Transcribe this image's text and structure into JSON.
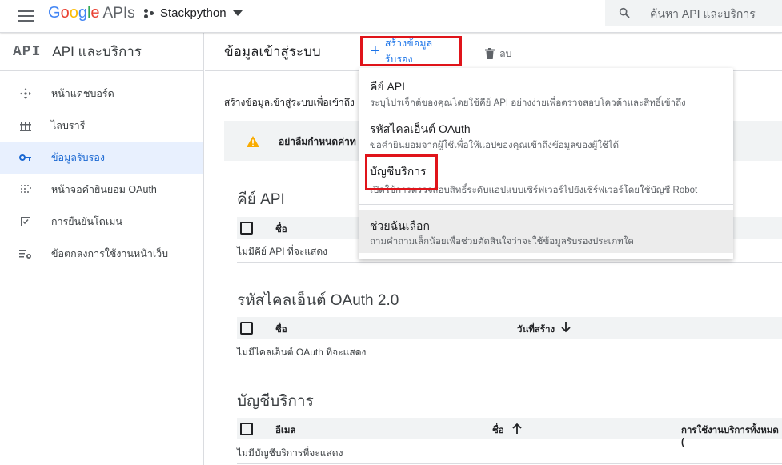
{
  "topbar": {
    "logo_google": [
      "G",
      "o",
      "o",
      "g",
      "l",
      "e"
    ],
    "logo_apis": "APIs",
    "project_name": "Stackpython",
    "search_placeholder": "ค้นหา API และบริการ"
  },
  "sidebar": {
    "api_badge": "API",
    "title": "API และบริการ",
    "items": [
      {
        "label": "หน้าแดชบอร์ด",
        "icon": "dashboard-icon",
        "active": false
      },
      {
        "label": "ไลบรารี",
        "icon": "library-icon",
        "active": false
      },
      {
        "label": "ข้อมูลรับรอง",
        "icon": "key-icon",
        "active": true
      },
      {
        "label": "หน้าจอคำยินยอม OAuth",
        "icon": "consent-icon",
        "active": false
      },
      {
        "label": "การยืนยันโดเมน",
        "icon": "domain-check-icon",
        "active": false
      },
      {
        "label": "ข้อตกลงการใช้งานหน้าเว็บ",
        "icon": "settings-list-icon",
        "active": false
      }
    ]
  },
  "toolbar": {
    "page_title": "ข้อมูลเข้าสู่ระบบ",
    "create_label": "สร้างข้อมูลรับรอง",
    "delete_label": "ลบ"
  },
  "main": {
    "intro": "สร้างข้อมูลเข้าสู่ระบบเพื่อเข้าถึง",
    "notice": "อย่าลืมกำหนดค่าท",
    "api_keys": {
      "title": "คีย์ API",
      "columns": [
        "ชื่อ"
      ],
      "empty": "ไม่มีคีย์ API ที่จะแสดง"
    },
    "oauth": {
      "title": "รหัสไคลเอ็นต์ OAuth 2.0",
      "columns": [
        "ชื่อ",
        "วันที่สร้าง"
      ],
      "empty": "ไม่มีไคลเอ็นต์ OAuth ที่จะแสดง"
    },
    "service_accounts": {
      "title": "บัญชีบริการ",
      "columns": [
        "อีเมล",
        "ชื่อ",
        "การใช้งานบริการทั้งหมด ("
      ],
      "empty": "ไม่มีบัญชีบริการที่จะแสดง"
    }
  },
  "dropdown": {
    "items": [
      {
        "title": "คีย์ API",
        "desc": "ระบุโปรเจ็กต์ของคุณโดยใช้คีย์ API อย่างง่ายเพื่อตรวจสอบโควต้าและสิทธิ์เข้าถึง"
      },
      {
        "title": "รหัสไคลเอ็นต์ OAuth",
        "desc": "ขอคำยินยอมจากผู้ใช้เพื่อให้แอปของคุณเข้าถึงข้อมูลของผู้ใช้ได้"
      },
      {
        "title": "บัญชีบริการ",
        "desc": "เปิดใช้การตรวจสอบสิทธิ์ระดับแอปแบบเซิร์ฟเวอร์ไปยังเซิร์ฟเวอร์โดยใช้บัญชี Robot"
      },
      {
        "title": "ช่วยฉันเลือก",
        "desc": "ถามคำถามเล็กน้อยเพื่อช่วยตัดสินใจว่าจะใช้ข้อมูลรับรองประเภทใด"
      }
    ]
  },
  "colors": {
    "accent": "#1a73e8",
    "highlight_border": "#e0141a",
    "active_bg": "#e8f0fe",
    "warning": "#f9ab00"
  }
}
